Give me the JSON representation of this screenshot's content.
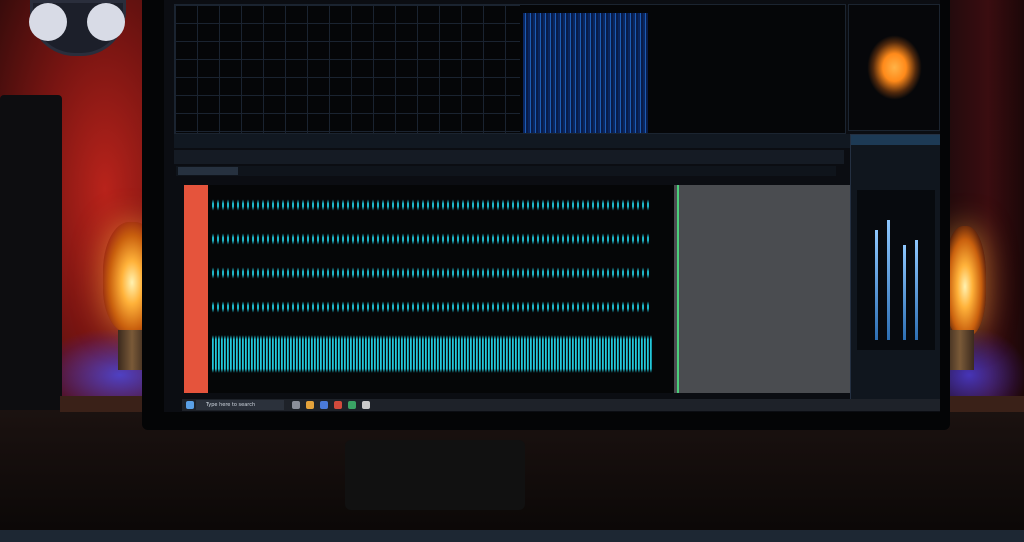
{
  "scene": {
    "description_labels": []
  },
  "window": {
    "toolbar_text": "",
    "tabs": [
      "",
      ""
    ],
    "right_panel_title": ""
  },
  "taskbar": {
    "search_placeholder": "Type here to search",
    "clock": ""
  },
  "colors": {
    "waveform": "#1fb7c9",
    "track_header": "#e5543c",
    "playhead": "#4bd07a",
    "spectrogram": "#1f66c8",
    "scope": "#ff8a1a"
  },
  "icons": [
    "search-icon",
    "start-icon",
    "app-icon"
  ]
}
